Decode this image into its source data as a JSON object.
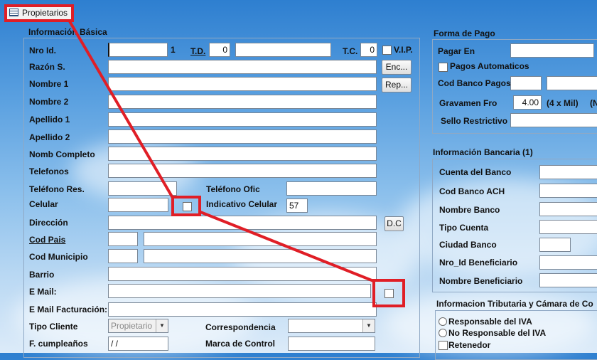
{
  "tab": {
    "title": "Propietarios",
    "icon": "table-icon"
  },
  "basic": {
    "title": "Información Básica",
    "nro_id": {
      "label": "Nro Id.",
      "value": "",
      "suffix": "1"
    },
    "td": {
      "label": "T.D.",
      "value": "0",
      "extra": ""
    },
    "tc": {
      "label": "T.C.",
      "value": "0"
    },
    "vip": {
      "label": "V.I.P."
    },
    "razon": "Razón S.",
    "nombre1": "Nombre 1",
    "nombre2": "Nombre 2",
    "apellido1": "Apellido 1",
    "apellido2": "Apellido 2",
    "nomb_completo": "Nomb Completo",
    "telefonos": "Telefonos",
    "tel_res": "Teléfono Res.",
    "tel_ofic": "Teléfono Ofic",
    "celular": "Celular",
    "indicativo": {
      "label": "Indicativo Celular",
      "value": "57"
    },
    "direccion": "Dirección",
    "cod_pais": "Cod Pais",
    "cod_municipio": "Cod Municipio",
    "barrio": "Barrio",
    "email": "E Mail:",
    "email_fact": "E Mail Facturación:",
    "tipo_cliente": {
      "label": "Tipo Cliente",
      "value": "Propietario"
    },
    "correspondencia": "Correspondencia",
    "cumpleanos": {
      "label": "F. cumpleaños",
      "value": " / /"
    },
    "marca_control": "Marca de Control",
    "buttons": {
      "enc": "Enc...",
      "rep": "Rep...",
      "dc": "D.C"
    }
  },
  "pago": {
    "title": "Forma de Pago",
    "pagar_en": "Pagar En",
    "pagos_auto": "Pagos Automaticos",
    "cod_banco": "Cod Banco Pagos",
    "gravamen": {
      "label": "Gravamen Fro",
      "value": "4.00",
      "note": "(4 x Mil)",
      "extra": "(N"
    },
    "sello": "Sello Restrictivo"
  },
  "bancaria": {
    "title": "Información Bancaria (1)",
    "cuenta": "Cuenta del Banco",
    "ach": "Cod Banco ACH",
    "nombre_banco": "Nombre Banco",
    "tipo_cuenta": "Tipo Cuenta",
    "ciudad": "Ciudad Banco",
    "nro_id_benef": "Nro_Id Beneficiario",
    "nombre_benef": "Nombre Beneficiario"
  },
  "tributaria": {
    "title": "Informacion Tributaria y Cámara de Co",
    "responsable": "Responsable del IVA",
    "no_responsable": "No Responsable del IVA",
    "retenedor": "Retenedor"
  },
  "colors": {
    "highlight": "#e01e26",
    "sky": "#5aa0e0"
  }
}
